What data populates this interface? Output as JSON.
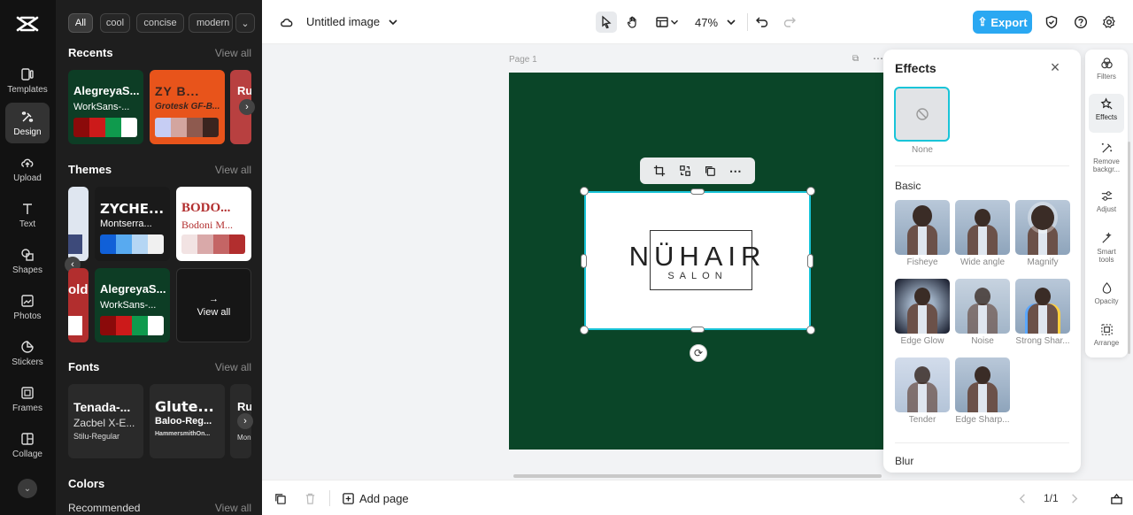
{
  "nav": {
    "items": [
      {
        "label": "Templates",
        "icon": "templates-icon"
      },
      {
        "label": "Design",
        "icon": "design-icon",
        "active": true
      },
      {
        "label": "Upload",
        "icon": "upload-icon"
      },
      {
        "label": "Text",
        "icon": "text-icon"
      },
      {
        "label": "Shapes",
        "icon": "shapes-icon"
      },
      {
        "label": "Photos",
        "icon": "photos-icon"
      },
      {
        "label": "Stickers",
        "icon": "stickers-icon"
      },
      {
        "label": "Frames",
        "icon": "frames-icon"
      },
      {
        "label": "Collage",
        "icon": "collage-icon"
      }
    ]
  },
  "panel": {
    "chips": [
      "All",
      "cool",
      "concise",
      "modern"
    ],
    "recents": {
      "title": "Recents",
      "view_all": "View all",
      "cards": [
        {
          "t1": "AlegreyaS...",
          "t2": "WorkSans-...",
          "bg": "#0d3d25",
          "colors": [
            "#8b0a0a",
            "#cc1a1a",
            "#0f9a4d",
            "#ffffff"
          ]
        },
        {
          "t1": "ZY B...",
          "t2": "Grotesk GF-B...",
          "bg": "#e8541b",
          "colors": [
            "#c6cdf4",
            "#d3a59f",
            "#8e5a4f",
            "#3a241f"
          ]
        },
        {
          "t1": "Ru",
          "t2": "",
          "bg": "#b84040",
          "colors": [
            "#b22e2e"
          ]
        }
      ]
    },
    "themes": {
      "title": "Themes",
      "view_all": "View all",
      "cards": [
        {
          "t1": "ZYCHE...",
          "t2": "Montserra...",
          "bg": "#1a1a1a",
          "colors": [
            "#1060d8",
            "#58aaf0",
            "#b5d6f4",
            "#f0f0f0"
          ]
        },
        {
          "t1": "BODO...",
          "t2": "Bodoni M...",
          "bg": "#ffffff",
          "colors": [
            "#f2e3e3",
            "#d9a9a9",
            "#c46565",
            "#b22e2e"
          ]
        },
        {
          "t1": "AlegreyaS...",
          "t2": "WorkSans-...",
          "bg": "#0d3d25",
          "colors": [
            "#8b0a0a",
            "#cc1a1a",
            "#0f9a4d",
            "#ffffff"
          ]
        }
      ],
      "partial_card_text": "old",
      "view_all_card": "View all"
    },
    "fonts": {
      "title": "Fonts",
      "view_all": "View all",
      "cards": [
        {
          "t1": "Tenada-...",
          "t2": "Zacbel X-E...",
          "t3": "Stilu-Regular"
        },
        {
          "t1": "Glute...",
          "t2": "Baloo-Reg...",
          "t3": "HammersmithOn..."
        },
        {
          "t1": "Ru",
          "t2": "",
          "t3": "Mon"
        }
      ]
    },
    "colors": {
      "title": "Colors",
      "recommended": "Recommended",
      "view_all": "View all"
    }
  },
  "topbar": {
    "doc_title": "Untitled image",
    "zoom": "47%",
    "export_label": "Export"
  },
  "canvas": {
    "page_label": "Page 1",
    "logo_text": "NÜHAIR",
    "logo_sub": "SALON",
    "artboard_color": "#0a4528"
  },
  "effects": {
    "title": "Effects",
    "none_label": "None",
    "basic_label": "Basic",
    "blur_label": "Blur",
    "items": [
      "Fisheye",
      "Wide angle",
      "Magnify",
      "Edge Glow",
      "Noise",
      "Strong Shar...",
      "Tender",
      "Edge Sharp..."
    ]
  },
  "rail": {
    "items": [
      {
        "label": "Filters",
        "icon": "filters-icon"
      },
      {
        "label": "Effects",
        "icon": "effects-icon",
        "active": true
      },
      {
        "label": "Remove backgr...",
        "icon": "remove-background-icon"
      },
      {
        "label": "Adjust",
        "icon": "adjust-icon"
      },
      {
        "label": "Smart tools",
        "icon": "smart-tools-icon"
      },
      {
        "label": "Opacity",
        "icon": "opacity-icon"
      },
      {
        "label": "Arrange",
        "icon": "arrange-icon"
      }
    ]
  },
  "bottombar": {
    "add_page": "Add page",
    "pager": "1/1"
  },
  "accent": "#2aa8f2",
  "selection_color": "#19c4d8"
}
